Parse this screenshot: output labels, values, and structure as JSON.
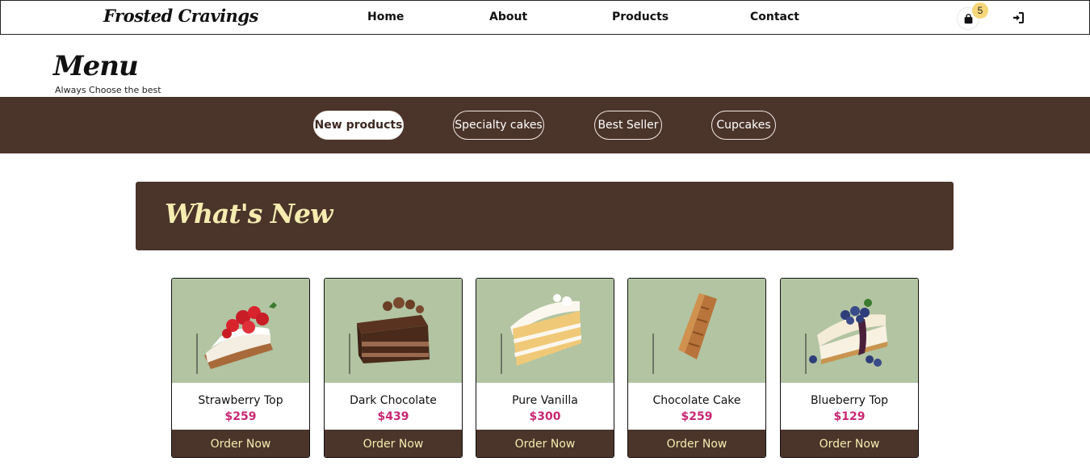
{
  "navbar": {
    "brand": "Frosted Cravings",
    "links": [
      {
        "label": "Home"
      },
      {
        "label": "About"
      },
      {
        "label": "Products"
      },
      {
        "label": "Contact"
      }
    ],
    "cart_count": "5",
    "icons": {
      "cart": "shopping-bag-icon",
      "login": "sign-in-icon"
    }
  },
  "menu": {
    "title": "Menu",
    "subtitle": "Always Choose the best"
  },
  "categories": [
    {
      "label": "New products",
      "active": true
    },
    {
      "label": "Specialty cakes",
      "active": false
    },
    {
      "label": "Best Seller",
      "active": false
    },
    {
      "label": "Cupcakes",
      "active": false
    }
  ],
  "section": {
    "title": "What's New"
  },
  "products": [
    {
      "name": "Strawberry Top",
      "price": "$259",
      "button": "Order Now"
    },
    {
      "name": "Dark Chocolate",
      "price": "$439",
      "button": "Order Now"
    },
    {
      "name": "Pure Vanilla",
      "price": "$300",
      "button": "Order Now"
    },
    {
      "name": "Chocolate Cake",
      "price": "$259",
      "button": "Order Now"
    },
    {
      "name": "Blueberry Top",
      "price": "$129",
      "button": "Order Now"
    }
  ],
  "colors": {
    "brown": "#4b342a",
    "cream": "#f6ecb0",
    "price": "#c72873",
    "card_bg": "#b2c4a2",
    "badge": "#f6d77a"
  }
}
